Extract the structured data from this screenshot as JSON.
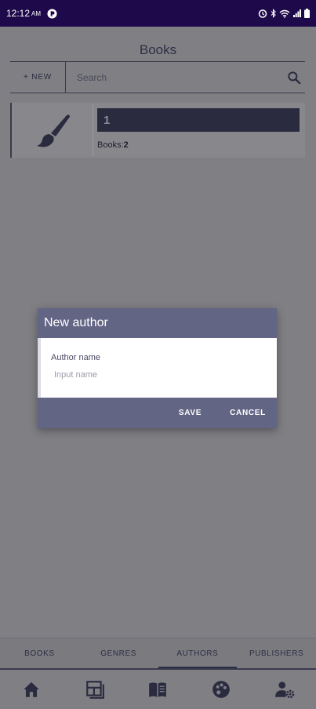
{
  "status_bar": {
    "time": "12:12",
    "time_suffix": "AM",
    "icons": [
      "notification-app-icon",
      "alarm-icon",
      "bluetooth-icon",
      "wifi-icon",
      "signal-icon",
      "battery-icon"
    ]
  },
  "header": {
    "title": "Books"
  },
  "toolbar": {
    "new_label": "+ NEW",
    "search_placeholder": "Search"
  },
  "author_card": {
    "name": "1",
    "books_label": "Books:",
    "books_count": "2",
    "icon": "brush-icon"
  },
  "dialog": {
    "title": "New author",
    "field_label": "Author name",
    "field_placeholder": "Input name",
    "field_value": "",
    "save_label": "SAVE",
    "cancel_label": "CANCEL"
  },
  "tabs": [
    {
      "label": "BOOKS",
      "active": false
    },
    {
      "label": "GENRES",
      "active": false
    },
    {
      "label": "AUTHORS",
      "active": true
    },
    {
      "label": "PUBLISHERS",
      "active": false
    }
  ],
  "bottom_nav": [
    "home-icon",
    "dashboard-icon",
    "book-open-icon",
    "palette-icon",
    "user-settings-icon"
  ],
  "colors": {
    "status_bar": "#1e0a4a",
    "dialog_accent": "#636585",
    "dark": "#2b2b40",
    "scrim": "#7f7f84"
  }
}
